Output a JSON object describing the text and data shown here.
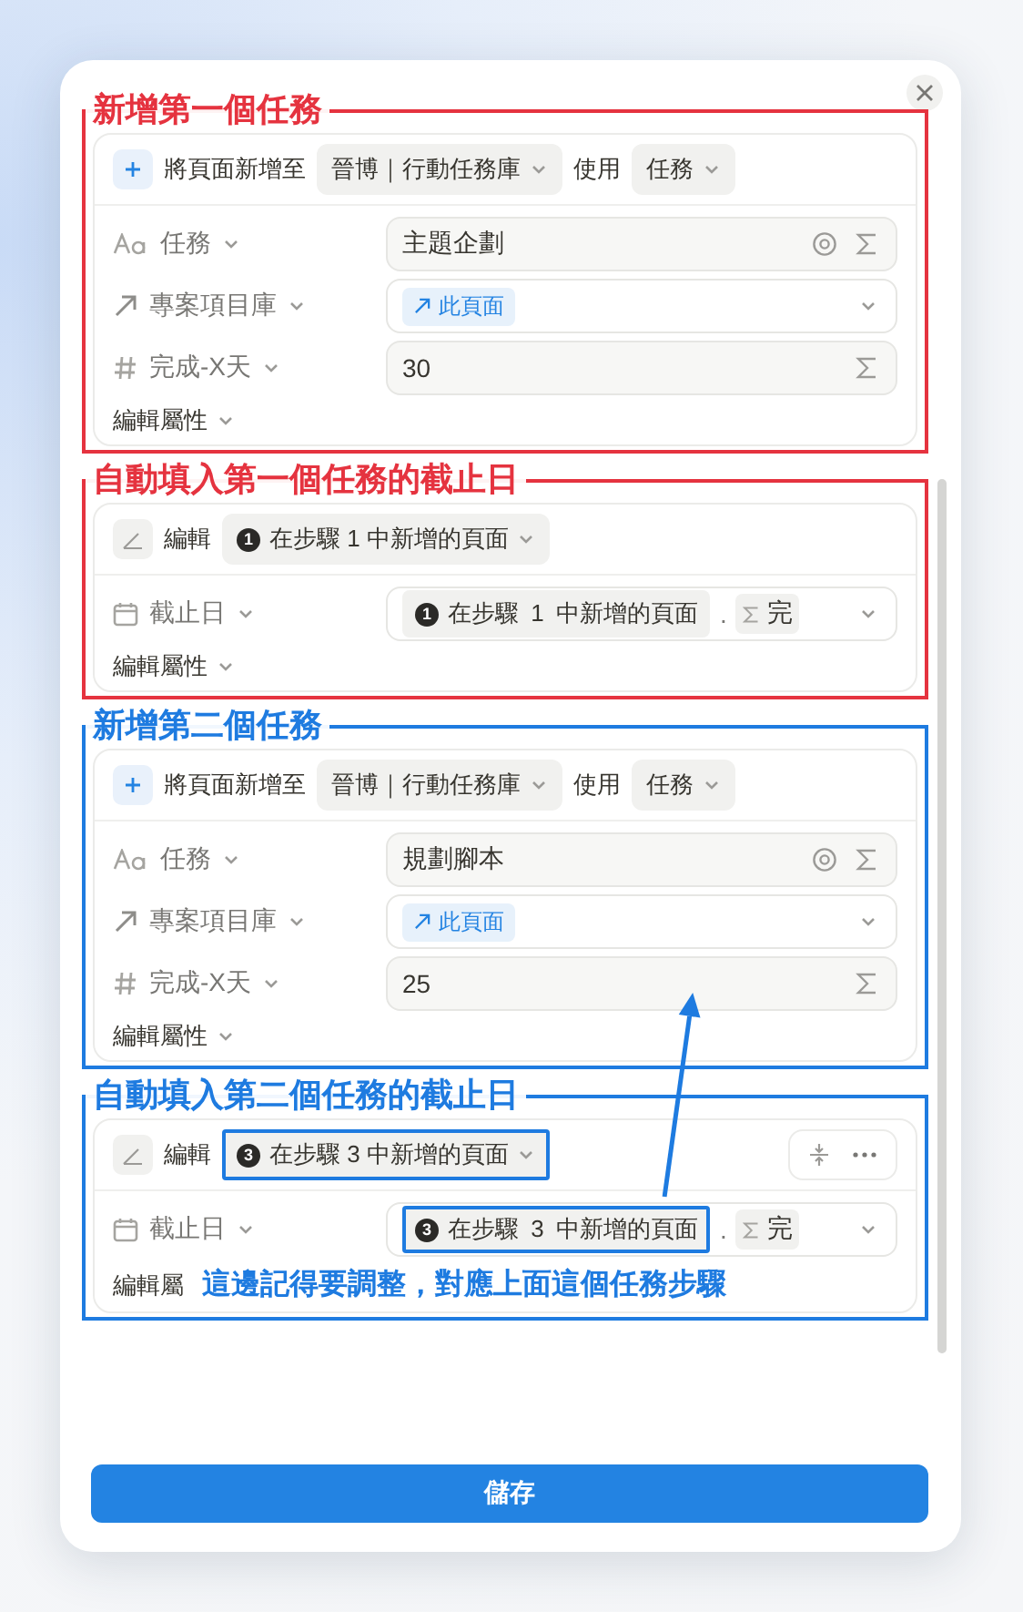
{
  "steps": [
    {
      "kind": "add_page",
      "annotation": {
        "text": "新增第一個任務",
        "color": "#e5333f"
      },
      "action": "將頁面新增至",
      "database": "晉博｜行動任務庫",
      "connector": "使用",
      "template": "任務",
      "show_actions": false,
      "properties": [
        {
          "kind": "title",
          "name": "任務",
          "value": "主題企劃"
        },
        {
          "kind": "relation",
          "name": "專案項目庫",
          "value": "此頁面"
        },
        {
          "kind": "number",
          "name": "完成-X天",
          "value": "30"
        }
      ],
      "footer": {
        "label": "編輯屬性",
        "expandable": true
      }
    },
    {
      "kind": "edit",
      "annotation": {
        "text": "自動填入第一個任務的截止日",
        "color": "#e5333f"
      },
      "action": "編輯",
      "target": {
        "step": "1",
        "text": "在步驟 1 中新增的頁面",
        "highlighted": false
      },
      "show_actions": false,
      "properties": [
        {
          "kind": "date",
          "name": "截止日",
          "value": {
            "step": "1",
            "text": "在步驟 1 中新增的頁面",
            "separator": ".",
            "formula": "完",
            "highlighted": false
          }
        }
      ],
      "footer": {
        "label": "編輯屬性",
        "expandable": true
      }
    },
    {
      "kind": "add_page",
      "annotation": {
        "text": "新增第二個任務",
        "color": "#1e7be0"
      },
      "action": "將頁面新增至",
      "database": "晉博｜行動任務庫",
      "connector": "使用",
      "template": "任務",
      "show_actions": false,
      "properties": [
        {
          "kind": "title",
          "name": "任務",
          "value": "規劃腳本"
        },
        {
          "kind": "relation",
          "name": "專案項目庫",
          "value": "此頁面"
        },
        {
          "kind": "number",
          "name": "完成-X天",
          "value": "25"
        }
      ],
      "footer": {
        "label": "編輯屬性",
        "expandable": true
      }
    },
    {
      "kind": "edit",
      "annotation": {
        "text": "自動填入第二個任務的截止日",
        "color": "#1e7be0",
        "note": "這邊記得要調整，對應上面這個任務步驟"
      },
      "action": "編輯",
      "target": {
        "step": "3",
        "text": "在步驟 3 中新增的頁面",
        "highlighted": true
      },
      "show_actions": true,
      "properties": [
        {
          "kind": "date",
          "name": "截止日",
          "value": {
            "step": "3",
            "text": "在步驟 3 中新增的頁面",
            "separator": ".",
            "formula": "完",
            "highlighted": true
          }
        }
      ],
      "footer": {
        "label": "編輯屬",
        "expandable": false
      }
    }
  ],
  "save_button": "儲存"
}
